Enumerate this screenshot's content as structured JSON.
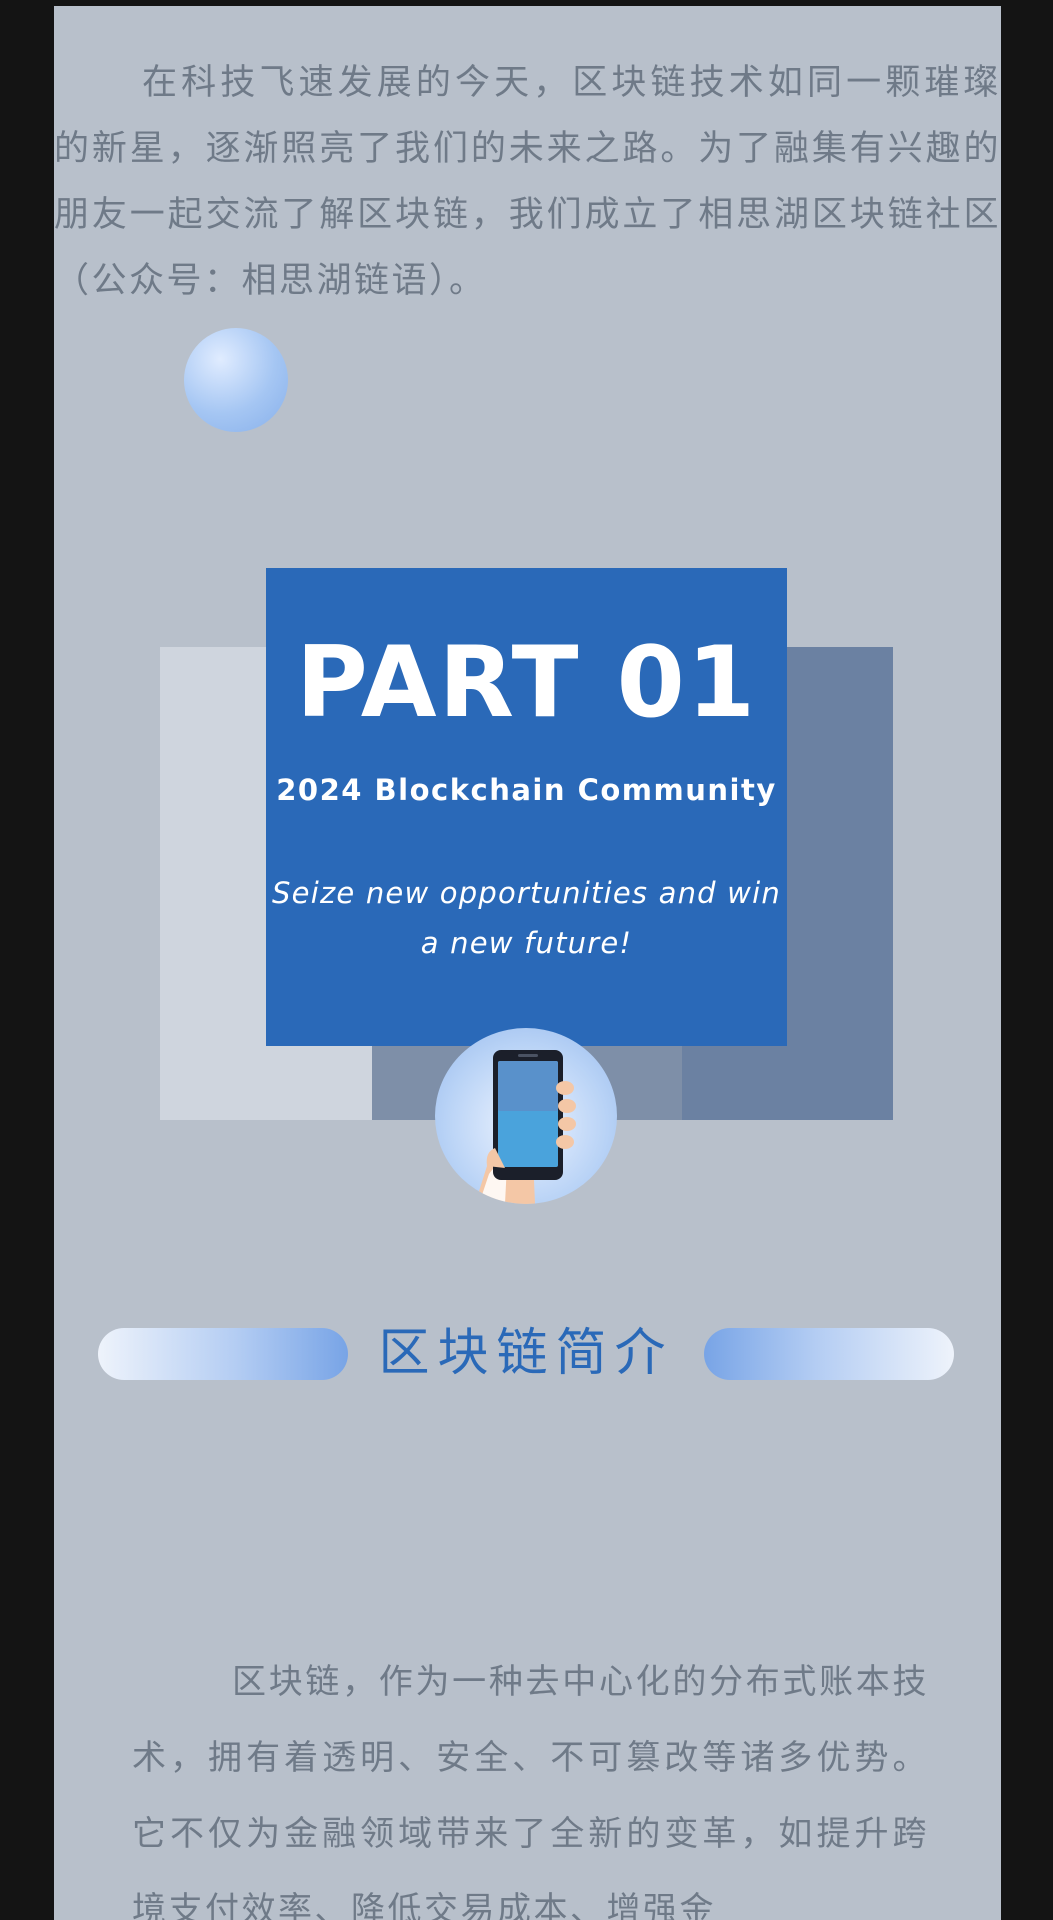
{
  "intro": {
    "text": "在科技飞速发展的今天，区块链技术如同一颗璀璨的新星，逐渐照亮了我们的未来之路。为了融集有兴趣的朋友一起交流了解区块链，我们成立了相思湖区块链社区（公众号：相思湖链语）。"
  },
  "part": {
    "title": "PART 01",
    "subtitle": "2024 Blockchain Community",
    "slogan": "Seize new opportunities and win a new future!"
  },
  "section": {
    "title": "区块链简介"
  },
  "body": {
    "text": "区块链，作为一种去中心化的分布式账本技术，拥有着透明、安全、不可篡改等诸多优势。它不仅为金融领域带来了全新的变革，如提升跨境支付效率、降低交易成本、增强金"
  },
  "icons": {
    "decor_bubble": "circle-bubble-icon",
    "phone": "hand-holding-phone-icon"
  },
  "colors": {
    "page_bg": "#b8c0cb",
    "accent": "#2a69b8",
    "text_muted": "#6f7a88"
  }
}
